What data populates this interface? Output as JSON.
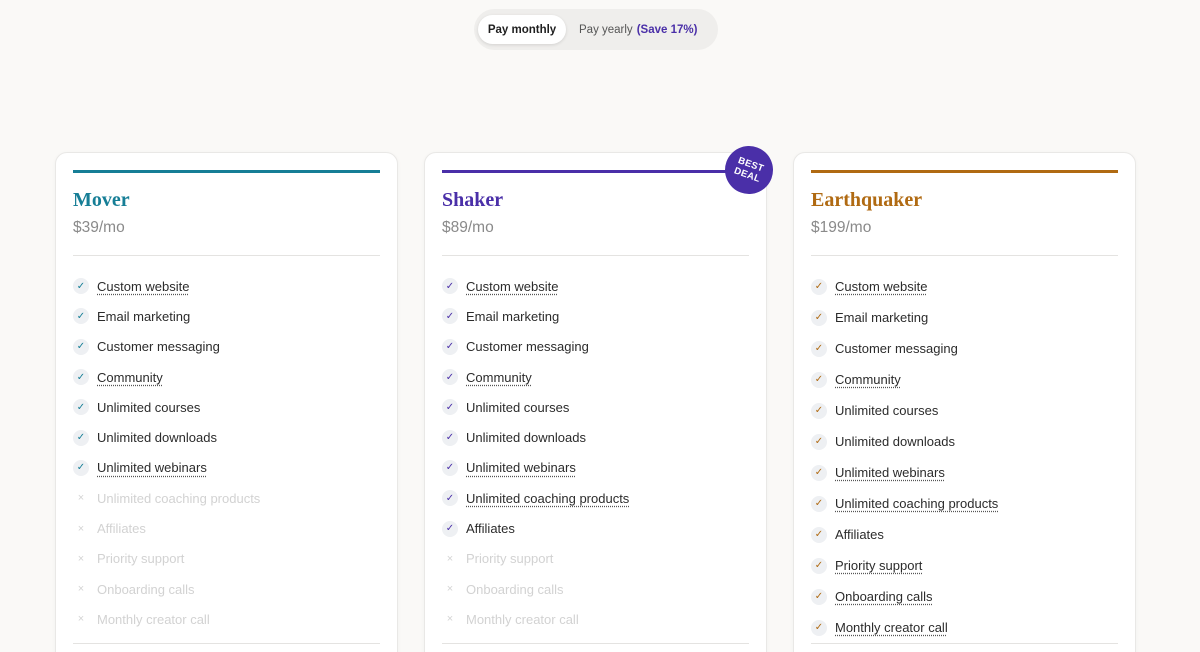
{
  "billing_toggle": {
    "monthly_label": "Pay monthly",
    "yearly_label": "Pay yearly",
    "yearly_save": "(Save 17%)",
    "selected": "monthly"
  },
  "badge": {
    "line1": "BEST",
    "line2": "DEAL"
  },
  "colors": {
    "mover": "#167e96",
    "shaker": "#4a2fa8",
    "earthquaker": "#b06a12",
    "accent_purple": "#4a2fa8"
  },
  "plans": [
    {
      "name": "Mover",
      "price": "$39/mo",
      "features": [
        {
          "label": "Custom website",
          "included": true,
          "tooltip": true
        },
        {
          "label": "Email marketing",
          "included": true,
          "tooltip": false
        },
        {
          "label": "Customer messaging",
          "included": true,
          "tooltip": false
        },
        {
          "label": "Community",
          "included": true,
          "tooltip": true
        },
        {
          "label": "Unlimited courses",
          "included": true,
          "tooltip": false
        },
        {
          "label": "Unlimited downloads",
          "included": true,
          "tooltip": false
        },
        {
          "label": "Unlimited webinars",
          "included": true,
          "tooltip": true
        },
        {
          "label": "Unlimited coaching products",
          "included": false,
          "tooltip": true
        },
        {
          "label": "Affiliates",
          "included": false,
          "tooltip": false
        },
        {
          "label": "Priority support",
          "included": false,
          "tooltip": true
        },
        {
          "label": "Onboarding calls",
          "included": false,
          "tooltip": true
        },
        {
          "label": "Monthly creator call",
          "included": false,
          "tooltip": true
        }
      ]
    },
    {
      "name": "Shaker",
      "price": "$89/mo",
      "features": [
        {
          "label": "Custom website",
          "included": true,
          "tooltip": true
        },
        {
          "label": "Email marketing",
          "included": true,
          "tooltip": false
        },
        {
          "label": "Customer messaging",
          "included": true,
          "tooltip": false
        },
        {
          "label": "Community",
          "included": true,
          "tooltip": true
        },
        {
          "label": "Unlimited courses",
          "included": true,
          "tooltip": false
        },
        {
          "label": "Unlimited downloads",
          "included": true,
          "tooltip": false
        },
        {
          "label": "Unlimited webinars",
          "included": true,
          "tooltip": true
        },
        {
          "label": "Unlimited coaching products",
          "included": true,
          "tooltip": true
        },
        {
          "label": "Affiliates",
          "included": true,
          "tooltip": false
        },
        {
          "label": "Priority support",
          "included": false,
          "tooltip": true
        },
        {
          "label": "Onboarding calls",
          "included": false,
          "tooltip": true
        },
        {
          "label": "Monthly creator call",
          "included": false,
          "tooltip": true
        }
      ]
    },
    {
      "name": "Earthquaker",
      "price": "$199/mo",
      "features": [
        {
          "label": "Custom website",
          "included": true,
          "tooltip": true
        },
        {
          "label": "Email marketing",
          "included": true,
          "tooltip": false
        },
        {
          "label": "Customer messaging",
          "included": true,
          "tooltip": false
        },
        {
          "label": "Community",
          "included": true,
          "tooltip": true
        },
        {
          "label": "Unlimited courses",
          "included": true,
          "tooltip": false
        },
        {
          "label": "Unlimited downloads",
          "included": true,
          "tooltip": false
        },
        {
          "label": "Unlimited webinars",
          "included": true,
          "tooltip": true
        },
        {
          "label": "Unlimited coaching products",
          "included": true,
          "tooltip": true
        },
        {
          "label": "Affiliates",
          "included": true,
          "tooltip": false
        },
        {
          "label": "Priority support",
          "included": true,
          "tooltip": true
        },
        {
          "label": "Onboarding calls",
          "included": true,
          "tooltip": true
        },
        {
          "label": "Monthly creator call",
          "included": true,
          "tooltip": true
        }
      ]
    }
  ]
}
